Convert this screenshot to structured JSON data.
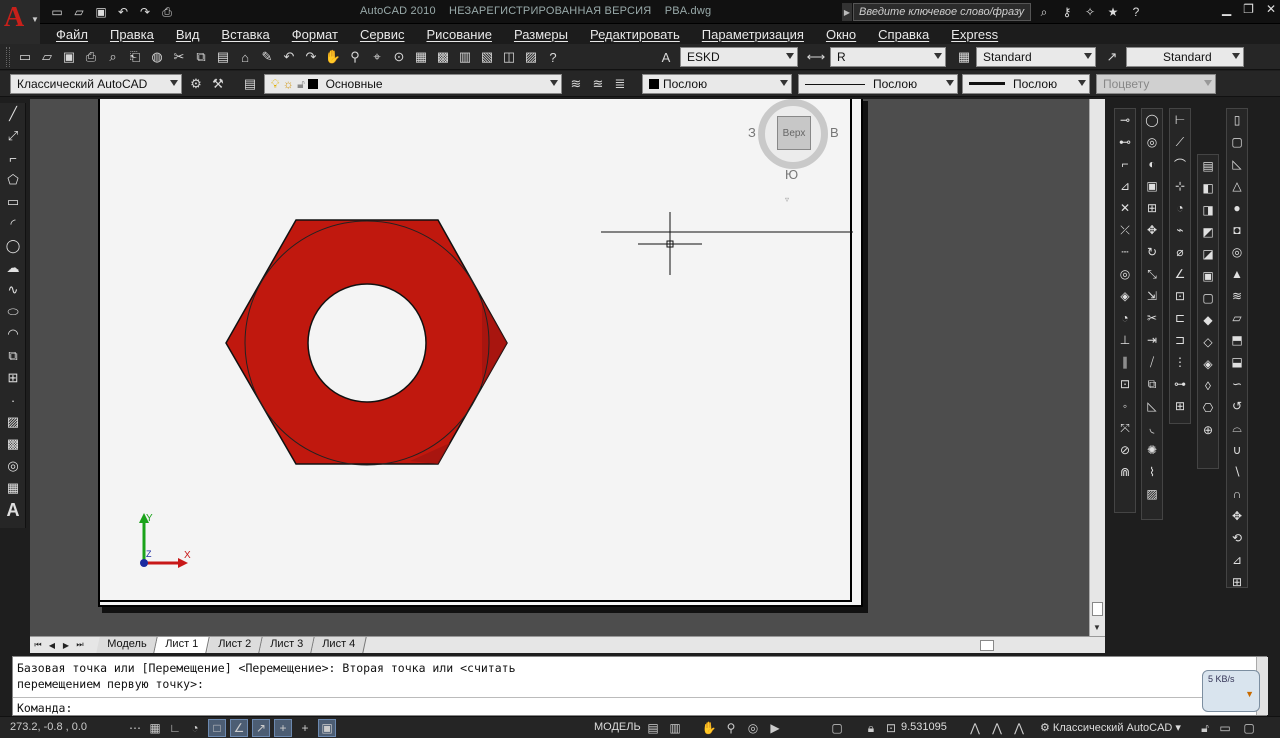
{
  "title_bar": {
    "app_name": "AutoCAD 2010",
    "status": "НЕЗАРЕГИСТРИРОВАННАЯ ВЕРСИЯ",
    "document": "PBA.dwg",
    "search_placeholder": "Введите ключевое слово/фразу"
  },
  "menu": {
    "items": [
      "Файл",
      "Правка",
      "Вид",
      "Вставка",
      "Формат",
      "Сервис",
      "Рисование",
      "Размеры",
      "Редактировать",
      "Параметризация",
      "Окно",
      "Справка",
      "Express"
    ]
  },
  "toolbar": {
    "text_style": "ESKD",
    "dim_style": "R",
    "table_style": "Standard",
    "multileader_style": "Standard",
    "workspace": "Классический AutoCAD",
    "layer": "Основные",
    "color": "Послою",
    "linetype": "Послою",
    "lineweight": "Послою",
    "plot_style": "Поцвету"
  },
  "viewcube": {
    "face": "Верх",
    "west": "З",
    "east": "В",
    "south": "Ю"
  },
  "ucs": {
    "x_label": "X",
    "y_label": "Y",
    "z_label": "Z"
  },
  "layout_tabs": [
    "Модель",
    "Лист 1",
    "Лист 2",
    "Лист 3",
    "Лист 4"
  ],
  "active_tab": "Лист 1",
  "command_line": {
    "history_line1": "Базовая точка или [Перемещение] <Перемещение>: Вторая точка или <считать",
    "history_line2": "перемещением первую точку>:",
    "prompt": "Команда:"
  },
  "net_widget": {
    "speed": "5 KB/s"
  },
  "status_bar": {
    "coordinates": "273.2, -0.8 , 0.0",
    "space": "МОДЕЛЬ",
    "annotation_scale": "9.531095",
    "workspace": "Классический AutoCAD"
  },
  "colors": {
    "nut_fill": "#c0180e",
    "nut_dark": "#9e1410",
    "background_dark": "#1e1e1e",
    "paper": "#f4f4f4"
  },
  "icons": {
    "app": "autocad-logo-icon",
    "draw_tools": [
      "line-icon",
      "construction-line-icon",
      "polyline-icon",
      "polygon-icon",
      "rectangle-icon",
      "arc-icon",
      "circle-icon",
      "revision-cloud-icon",
      "spline-icon",
      "ellipse-icon",
      "ellipse-arc-icon",
      "insert-block-icon",
      "make-block-icon",
      "point-icon",
      "hatch-icon",
      "gradient-icon",
      "region-icon",
      "table-icon",
      "multiline-text-icon"
    ]
  }
}
